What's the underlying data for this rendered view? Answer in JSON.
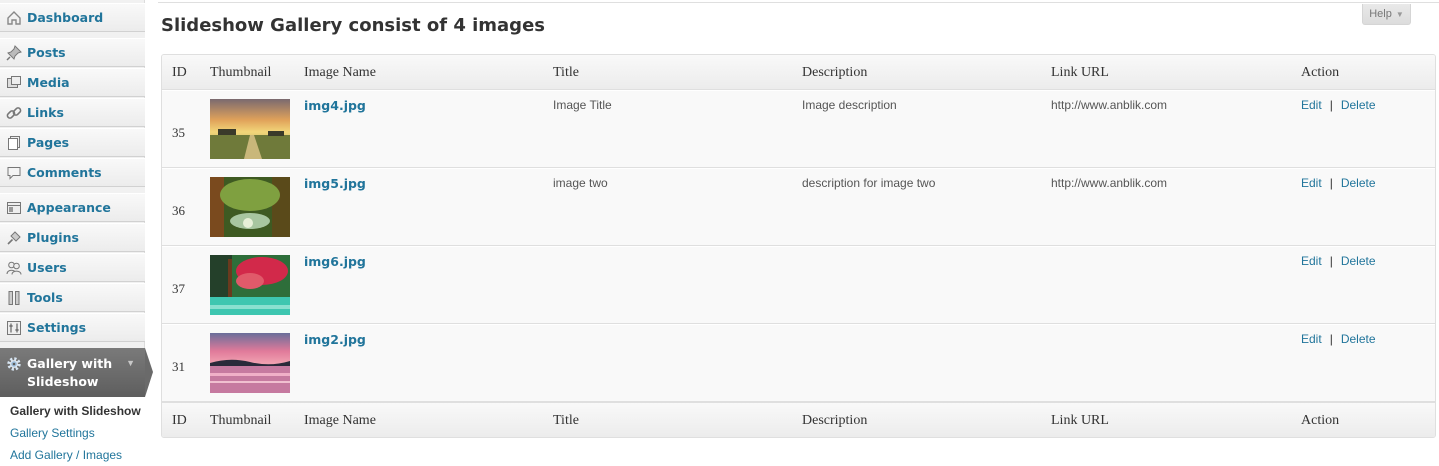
{
  "sidebar": {
    "items": [
      {
        "label": "Dashboard",
        "icon": "dashboard-icon"
      },
      {
        "label": "Posts",
        "icon": "pushpin-icon"
      },
      {
        "label": "Media",
        "icon": "media-icon"
      },
      {
        "label": "Links",
        "icon": "chain-link-icon"
      },
      {
        "label": "Pages",
        "icon": "pages-icon"
      },
      {
        "label": "Comments",
        "icon": "comment-bubble-icon"
      },
      {
        "label": "Appearance",
        "icon": "appearance-icon"
      },
      {
        "label": "Plugins",
        "icon": "plug-icon"
      },
      {
        "label": "Users",
        "icon": "users-icon"
      },
      {
        "label": "Tools",
        "icon": "tools-icon"
      },
      {
        "label": "Settings",
        "icon": "settings-icon"
      }
    ],
    "active": {
      "label": "Gallery with Slideshow",
      "icon": "gear-icon"
    },
    "submenu": [
      {
        "label": "Gallery with Slideshow",
        "current": true
      },
      {
        "label": "Gallery Settings",
        "current": false
      },
      {
        "label": "Add Gallery / Images",
        "current": false
      }
    ]
  },
  "header": {
    "help_label": "Help"
  },
  "main": {
    "title": "Slideshow Gallery consist of 4 images",
    "columns": [
      "ID",
      "Thumbnail",
      "Image Name",
      "Title",
      "Description",
      "Link URL",
      "Action"
    ],
    "rows": [
      {
        "id": "35",
        "name": "img4.jpg",
        "title": "Image Title",
        "description": "Image description",
        "url": "http://www.anblik.com",
        "thumb": "sunset-field"
      },
      {
        "id": "36",
        "name": "img5.jpg",
        "title": "image two",
        "description": "description for image two",
        "url": "http://www.anblik.com",
        "thumb": "forest-stream"
      },
      {
        "id": "37",
        "name": "img6.jpg",
        "title": "",
        "description": "",
        "url": "",
        "thumb": "autumn-tree-river"
      },
      {
        "id": "31",
        "name": "img2.jpg",
        "title": "",
        "description": "",
        "url": "",
        "thumb": "pink-sunset-lake"
      }
    ],
    "action_edit": "Edit",
    "action_delete": "Delete",
    "action_separator": "|"
  },
  "colors": {
    "link": "#21759b",
    "active_menu": "#6a6a6a",
    "sidebar_bg": "#f1f1f1"
  }
}
